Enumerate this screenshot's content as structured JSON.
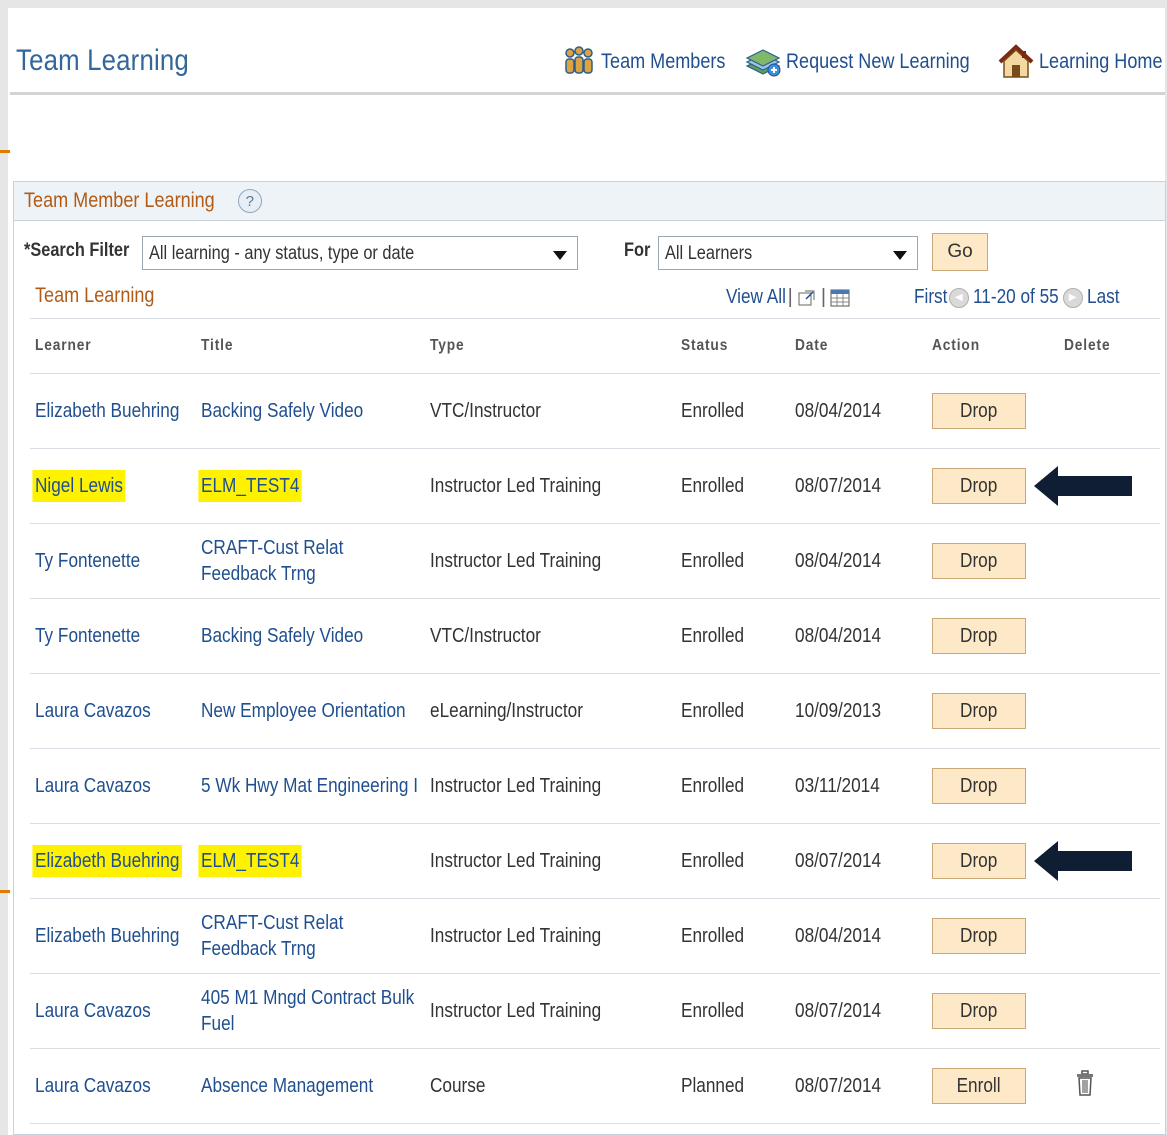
{
  "page": {
    "title": "Team Learning",
    "header_links": [
      {
        "label": "Team Members",
        "icon": "team-members-icon"
      },
      {
        "label": "Request New Learning",
        "icon": "request-learning-icon"
      },
      {
        "label": "Learning Home",
        "icon": "home-icon"
      }
    ]
  },
  "panel": {
    "title": "Team Member Learning",
    "help_icon": "?",
    "filter": {
      "label": "*Search Filter",
      "value": "All learning - any status, type or date",
      "for_label": "For",
      "for_value": "All Learners",
      "go_label": "Go"
    },
    "grid": {
      "title": "Team Learning",
      "view_all": "View All",
      "first": "First",
      "range": "11-20 of 55",
      "last": "Last",
      "columns": [
        "Learner",
        "Title",
        "Type",
        "Status",
        "Date",
        "Action",
        "Delete"
      ],
      "rows": [
        {
          "learner": "Elizabeth Buehring",
          "title": [
            "Backing Safely Video"
          ],
          "type": "VTC/Instructor",
          "status": "Enrolled",
          "date": "08/04/2014",
          "action": "Drop",
          "delete": false,
          "highlight": false,
          "arrow": false
        },
        {
          "learner": "Nigel Lewis",
          "title": [
            "ELM_TEST4"
          ],
          "type": "Instructor Led Training",
          "status": "Enrolled",
          "date": "08/07/2014",
          "action": "Drop",
          "delete": false,
          "highlight": true,
          "arrow": true
        },
        {
          "learner": "Ty Fontenette",
          "title": [
            "CRAFT-Cust Relat",
            "Feedback Trng"
          ],
          "type": "Instructor Led Training",
          "status": "Enrolled",
          "date": "08/04/2014",
          "action": "Drop",
          "delete": false,
          "highlight": false,
          "arrow": false
        },
        {
          "learner": "Ty Fontenette",
          "title": [
            "Backing Safely Video"
          ],
          "type": "VTC/Instructor",
          "status": "Enrolled",
          "date": "08/04/2014",
          "action": "Drop",
          "delete": false,
          "highlight": false,
          "arrow": false
        },
        {
          "learner": "Laura Cavazos",
          "title": [
            "New Employee Orientation"
          ],
          "type": "eLearning/Instructor",
          "status": "Enrolled",
          "date": "10/09/2013",
          "action": "Drop",
          "delete": false,
          "highlight": false,
          "arrow": false
        },
        {
          "learner": "Laura Cavazos",
          "title": [
            "5 Wk Hwy Mat Engineering I"
          ],
          "type": "Instructor Led Training",
          "status": "Enrolled",
          "date": "03/11/2014",
          "action": "Drop",
          "delete": false,
          "highlight": false,
          "arrow": false
        },
        {
          "learner": "Elizabeth Buehring",
          "title": [
            "ELM_TEST4"
          ],
          "type": "Instructor Led Training",
          "status": "Enrolled",
          "date": "08/07/2014",
          "action": "Drop",
          "delete": false,
          "highlight": true,
          "arrow": true
        },
        {
          "learner": "Elizabeth Buehring",
          "title": [
            "CRAFT-Cust Relat",
            "Feedback Trng"
          ],
          "type": "Instructor Led Training",
          "status": "Enrolled",
          "date": "08/04/2014",
          "action": "Drop",
          "delete": false,
          "highlight": false,
          "arrow": false
        },
        {
          "learner": "Laura Cavazos",
          "title": [
            "405 M1 Mngd Contract Bulk",
            "Fuel"
          ],
          "type": "Instructor Led Training",
          "status": "Enrolled",
          "date": "08/07/2014",
          "action": "Drop",
          "delete": false,
          "highlight": false,
          "arrow": false
        },
        {
          "learner": "Laura Cavazos",
          "title": [
            "Absence Management"
          ],
          "type": "Course",
          "status": "Planned",
          "date": "08/07/2014",
          "action": "Enroll",
          "delete": true,
          "highlight": false,
          "arrow": false
        }
      ]
    }
  },
  "colors": {
    "link": "#1f4f8f",
    "section_label": "#b15b16",
    "highlight": "#fff200",
    "button_bg": "#fde9c8",
    "annotation_arrow": "#0f1e33"
  }
}
